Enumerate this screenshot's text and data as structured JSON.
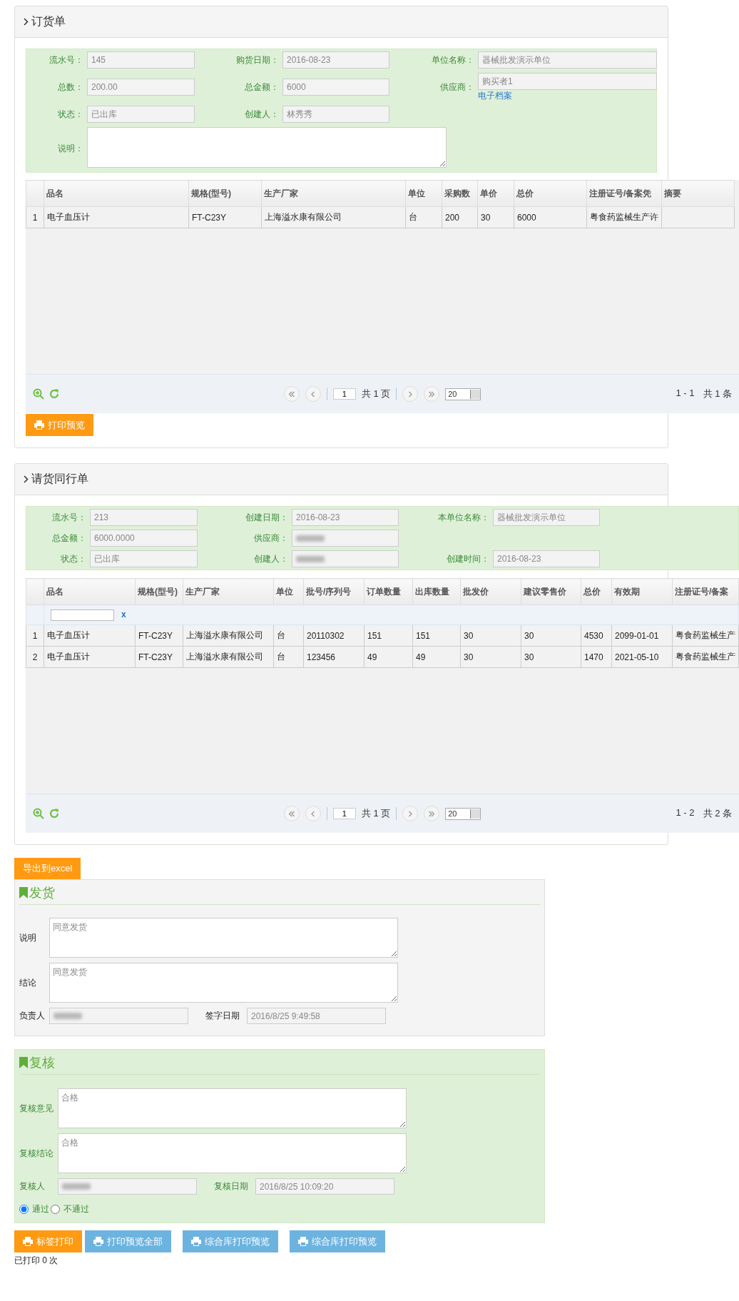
{
  "order": {
    "title": "订货单",
    "form_rows": [
      [
        {
          "kind": "input",
          "label": "流水号：",
          "value": "145"
        },
        {
          "kind": "input",
          "label": "购货日期：",
          "value": "2016-08-23"
        },
        {
          "kind": "input",
          "label": "单位名称：",
          "value": "器械批发演示单位"
        }
      ],
      [
        {
          "kind": "input",
          "label": "总数：",
          "value": "200.00"
        },
        {
          "kind": "input",
          "label": "总金额：",
          "value": "6000"
        },
        {
          "kind": "input",
          "label": "供应商：",
          "value": "购买者1",
          "link": "电子档案"
        }
      ],
      [
        {
          "kind": "input",
          "label": "状态：",
          "value": "已出库"
        },
        {
          "kind": "input",
          "label": "创建人：",
          "value": "林秀秀"
        }
      ],
      [
        {
          "kind": "textarea",
          "label": "说明："
        }
      ]
    ],
    "table": {
      "columns": [
        "品名",
        "规格(型号)",
        "生产厂家",
        "单位",
        "采购数",
        "单价",
        "总价",
        "注册证号/备案凭",
        "摘要"
      ],
      "rows": [
        {
          "no": "1",
          "cells": [
            "电子血压计",
            "FT-C23Y",
            "上海溢水康有限公司",
            "台",
            "200",
            "30",
            "6000",
            "粤食药监械生产许"
          ]
        }
      ]
    },
    "pager": {
      "page": "1",
      "pages": "共 1 页",
      "page_size": "20",
      "range": "1 - 1",
      "total": "共 1 条"
    },
    "print_button": "打印预览"
  },
  "request": {
    "title": "请货同行单",
    "form_rows": [
      [
        {
          "kind": "input",
          "label": "流水号：",
          "value": "213"
        },
        {
          "kind": "input",
          "label": "创建日期：",
          "value": "2016-08-23"
        },
        {
          "kind": "input",
          "label": "本单位名称：",
          "value": "器械批发演示单位"
        }
      ],
      [
        {
          "kind": "input",
          "label": "总金额：",
          "value": "6000.0000"
        },
        {
          "kind": "input",
          "label": "供应商：",
          "redacted": true
        }
      ],
      [
        {
          "kind": "input",
          "label": "状态：",
          "value": "已出库"
        },
        {
          "kind": "input",
          "label": "创建人：",
          "redacted": true
        },
        {
          "kind": "input",
          "label": "创建时间：",
          "value": "2016-08-23"
        }
      ]
    ],
    "table": {
      "columns": [
        "品名",
        "规格(型号)",
        "生产厂家",
        "单位",
        "批号/序列号",
        "订单数量",
        "出库数量",
        "批发价",
        "建议零售价",
        "总价",
        "有效期",
        "注册证号/备案"
      ],
      "filter": {
        "clear": "x"
      },
      "rows": [
        {
          "no": "1",
          "cells": [
            "电子血压计",
            "FT-C23Y",
            "上海溢水康有限公司",
            "台",
            "20110302",
            "151",
            "151",
            "30",
            "30",
            "4530",
            "2099-01-01",
            "粤食药监械生产"
          ]
        },
        {
          "no": "2",
          "cells": [
            "电子血压计",
            "FT-C23Y",
            "上海溢水康有限公司",
            "台",
            "123456",
            "49",
            "49",
            "30",
            "30",
            "1470",
            "2021-05-10",
            "粤食药监械生产"
          ]
        }
      ]
    },
    "pager": {
      "page": "1",
      "pages": "共 1 页",
      "page_size": "20",
      "range": "1 - 2",
      "total": "共 2 条"
    }
  },
  "export_button": "导出到excel",
  "shipping": {
    "title": "发货",
    "rows": [
      [
        {
          "kind": "textarea",
          "label": "说明",
          "value": "同意发货"
        }
      ],
      [
        {
          "kind": "textarea",
          "label": "结论",
          "value": "同意发货"
        }
      ],
      [
        {
          "kind": "input",
          "label": "负责人",
          "redacted": true
        },
        {
          "kind": "input",
          "label": "签字日期",
          "value": "2016/8/25 9:49:58"
        }
      ]
    ]
  },
  "review": {
    "title": "复核",
    "rows": [
      [
        {
          "kind": "textarea",
          "label": "复核意见",
          "value": "合格"
        }
      ],
      [
        {
          "kind": "textarea",
          "label": "复核结论",
          "value": "合格"
        }
      ],
      [
        {
          "kind": "input",
          "label": "复核人",
          "redacted": true
        },
        {
          "kind": "input",
          "label": "复核日期",
          "value": "2016/8/25 10:09:20"
        }
      ]
    ],
    "radios": [
      {
        "label": "通过",
        "selected": true
      },
      {
        "label": "不通过",
        "selected": false
      }
    ]
  },
  "buttons": [
    {
      "label": "标签打印",
      "kind": "primary"
    },
    {
      "label": "打印预览全部",
      "kind": "secondary"
    },
    {
      "label": "综合库打印预览",
      "kind": "secondary"
    },
    {
      "label": "综合库打印预览",
      "kind": "secondary"
    }
  ],
  "print_count": "已打印 0 次"
}
